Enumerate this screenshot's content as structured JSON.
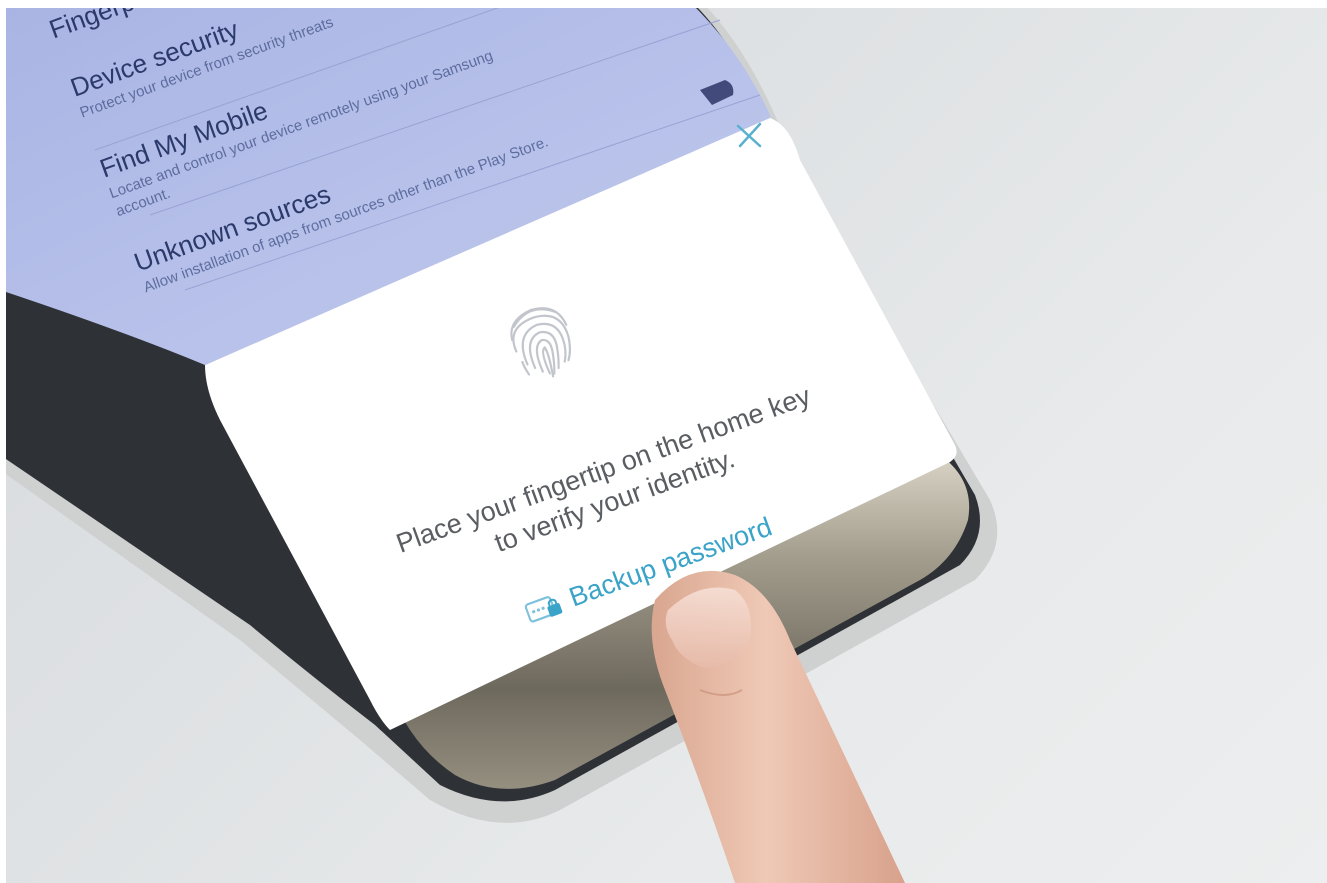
{
  "settings": {
    "items": [
      {
        "title": "Fingerprints",
        "sub": ""
      },
      {
        "title": "Device security",
        "sub": "Protect your device from security threats"
      },
      {
        "title": "Find My Mobile",
        "sub": "Locate and control your device remotely using your Samsung",
        "sub2": "account."
      },
      {
        "title": "Unknown sources",
        "sub": "Allow installation of apps from sources other than the Play Store."
      }
    ]
  },
  "dialog": {
    "message_line1": "Place your fingertip on the home key",
    "message_line2": "to verify your identity.",
    "backup_label": "Backup password",
    "close_icon": "close-icon",
    "fingerprint_icon": "fingerprint-icon",
    "password_icon": "password-lock-icon"
  },
  "colors": {
    "accent": "#3aa3c8",
    "settings_bg": "#b3bde8",
    "dialog_bg": "#ffffff",
    "text": "#5a5d62"
  }
}
